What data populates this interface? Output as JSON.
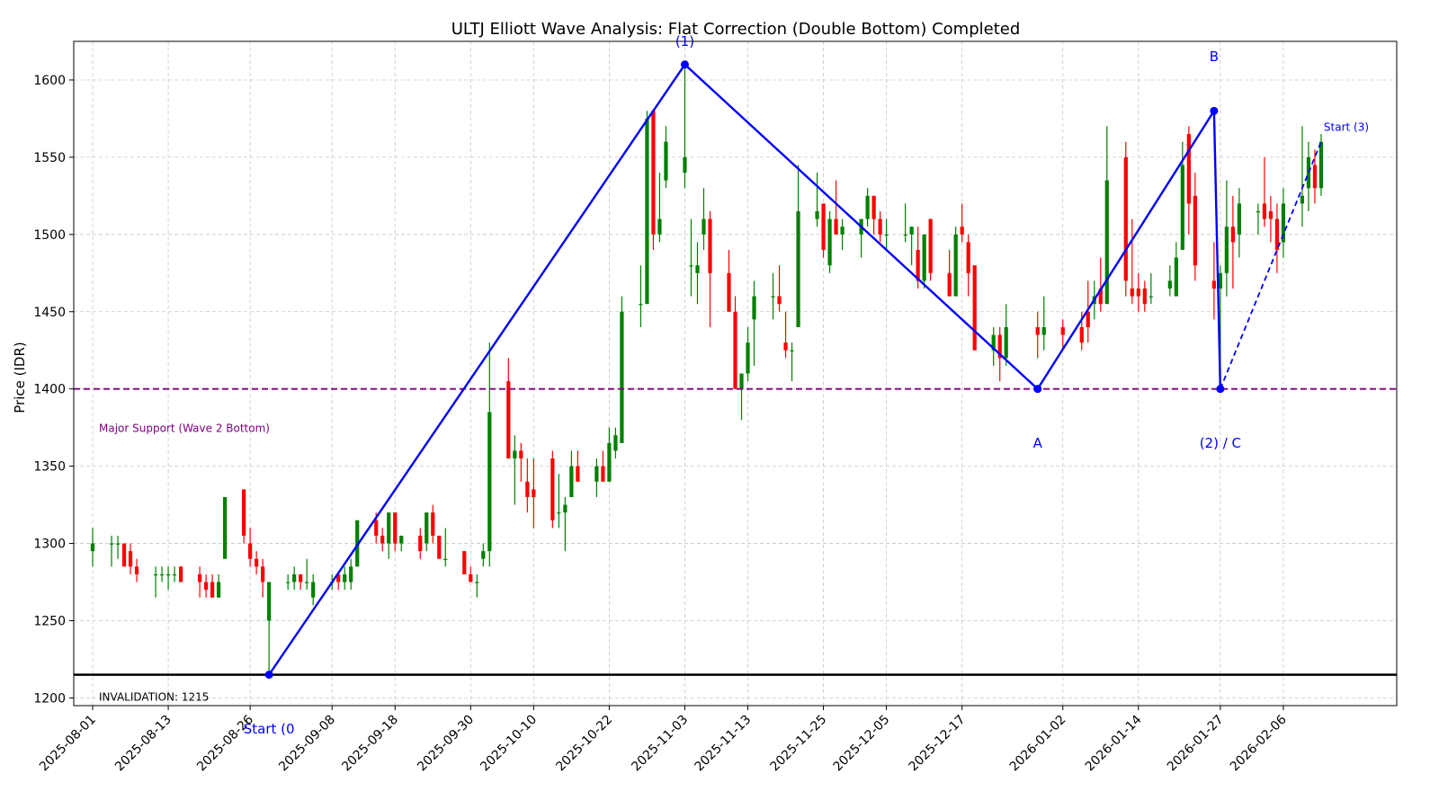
{
  "chart_data": {
    "type": "candlestick",
    "title": "ULTJ Elliott Wave Analysis: Flat Correction (Double Bottom) Completed",
    "xlabel": "",
    "ylabel": "Price (IDR)",
    "ylim": [
      1195,
      1625
    ],
    "x_range": [
      "2025-07-29",
      "2026-02-24"
    ],
    "y_ticks": [
      1200,
      1250,
      1300,
      1350,
      1400,
      1450,
      1500,
      1550,
      1600
    ],
    "x_ticks": [
      "2025-08-01",
      "2025-08-13",
      "2025-08-26",
      "2025-09-08",
      "2025-09-18",
      "2025-09-30",
      "2025-10-10",
      "2025-10-22",
      "2025-11-03",
      "2025-11-13",
      "2025-11-25",
      "2025-12-05",
      "2025-12-17",
      "2026-01-02",
      "2026-01-14",
      "2026-01-27",
      "2026-02-06"
    ],
    "grid": true,
    "colors": {
      "up": "#008000",
      "down": "#ff0000",
      "wave": "#0000ff",
      "support": "#800080",
      "invalidation": "#000000"
    },
    "candles": [
      [
        "2025-08-01",
        1295,
        1310,
        1285,
        1300
      ],
      [
        "2025-08-04",
        1300,
        1305,
        1285,
        1300
      ],
      [
        "2025-08-05",
        1300,
        1305,
        1290,
        1300
      ],
      [
        "2025-08-06",
        1300,
        1300,
        1285,
        1285
      ],
      [
        "2025-08-07",
        1295,
        1300,
        1280,
        1285
      ],
      [
        "2025-08-08",
        1285,
        1290,
        1275,
        1280
      ],
      [
        "2025-08-11",
        1280,
        1285,
        1265,
        1280
      ],
      [
        "2025-08-12",
        1280,
        1285,
        1275,
        1280
      ],
      [
        "2025-08-13",
        1280,
        1285,
        1270,
        1280
      ],
      [
        "2025-08-14",
        1280,
        1285,
        1275,
        1280
      ],
      [
        "2025-08-15",
        1285,
        1285,
        1275,
        1275
      ],
      [
        "2025-08-18",
        1280,
        1285,
        1265,
        1275
      ],
      [
        "2025-08-19",
        1275,
        1280,
        1265,
        1270
      ],
      [
        "2025-08-20",
        1275,
        1280,
        1265,
        1265
      ],
      [
        "2025-08-21",
        1265,
        1280,
        1265,
        1275
      ],
      [
        "2025-08-22",
        1290,
        1330,
        1290,
        1330
      ],
      [
        "2025-08-25",
        1335,
        1335,
        1300,
        1305
      ],
      [
        "2025-08-26",
        1300,
        1310,
        1285,
        1290
      ],
      [
        "2025-08-27",
        1290,
        1295,
        1280,
        1285
      ],
      [
        "2025-08-28",
        1285,
        1290,
        1265,
        1275
      ],
      [
        "2025-08-29",
        1250,
        1275,
        1215,
        1275
      ],
      [
        "2025-09-01",
        1275,
        1280,
        1270,
        1275
      ],
      [
        "2025-09-02",
        1275,
        1285,
        1270,
        1280
      ],
      [
        "2025-09-03",
        1280,
        1280,
        1270,
        1275
      ],
      [
        "2025-09-04",
        1275,
        1290,
        1270,
        1275
      ],
      [
        "2025-09-05",
        1265,
        1280,
        1260,
        1275
      ],
      [
        "2025-09-08",
        1275,
        1280,
        1270,
        1275
      ],
      [
        "2025-09-09",
        1280,
        1280,
        1270,
        1275
      ],
      [
        "2025-09-10",
        1275,
        1285,
        1270,
        1280
      ],
      [
        "2025-09-11",
        1275,
        1290,
        1270,
        1285
      ],
      [
        "2025-09-12",
        1285,
        1315,
        1285,
        1315
      ],
      [
        "2025-09-15",
        1315,
        1320,
        1300,
        1305
      ],
      [
        "2025-09-16",
        1305,
        1310,
        1295,
        1300
      ],
      [
        "2025-09-17",
        1300,
        1320,
        1290,
        1320
      ],
      [
        "2025-09-18",
        1320,
        1320,
        1295,
        1300
      ],
      [
        "2025-09-19",
        1300,
        1305,
        1295,
        1305
      ],
      [
        "2025-09-22",
        1305,
        1310,
        1290,
        1295
      ],
      [
        "2025-09-23",
        1300,
        1320,
        1295,
        1320
      ],
      [
        "2025-09-24",
        1320,
        1325,
        1300,
        1305
      ],
      [
        "2025-09-25",
        1305,
        1305,
        1290,
        1290
      ],
      [
        "2025-09-26",
        1290,
        1310,
        1285,
        1290
      ],
      [
        "2025-09-29",
        1295,
        1295,
        1280,
        1280
      ],
      [
        "2025-09-30",
        1280,
        1285,
        1275,
        1275
      ],
      [
        "2025-10-01",
        1275,
        1280,
        1265,
        1275
      ],
      [
        "2025-10-02",
        1290,
        1300,
        1285,
        1295
      ],
      [
        "2025-10-03",
        1295,
        1430,
        1285,
        1385
      ],
      [
        "2025-10-06",
        1405,
        1420,
        1355,
        1355
      ],
      [
        "2025-10-07",
        1355,
        1370,
        1325,
        1360
      ],
      [
        "2025-10-08",
        1360,
        1365,
        1340,
        1355
      ],
      [
        "2025-10-09",
        1340,
        1355,
        1320,
        1330
      ],
      [
        "2025-10-10",
        1335,
        1355,
        1310,
        1330
      ],
      [
        "2025-10-13",
        1355,
        1360,
        1310,
        1315
      ],
      [
        "2025-10-14",
        1320,
        1345,
        1310,
        1320
      ],
      [
        "2025-10-15",
        1320,
        1330,
        1295,
        1325
      ],
      [
        "2025-10-16",
        1330,
        1360,
        1330,
        1350
      ],
      [
        "2025-10-17",
        1350,
        1360,
        1340,
        1340
      ],
      [
        "2025-10-20",
        1340,
        1355,
        1330,
        1350
      ],
      [
        "2025-10-21",
        1350,
        1360,
        1340,
        1340
      ],
      [
        "2025-10-22",
        1340,
        1375,
        1340,
        1365
      ],
      [
        "2025-10-23",
        1360,
        1375,
        1355,
        1370
      ],
      [
        "2025-10-24",
        1365,
        1460,
        1365,
        1450
      ],
      [
        "2025-10-27",
        1455,
        1480,
        1440,
        1455
      ],
      [
        "2025-10-28",
        1455,
        1580,
        1455,
        1575
      ],
      [
        "2025-10-29",
        1580,
        1580,
        1490,
        1500
      ],
      [
        "2025-10-30",
        1500,
        1540,
        1495,
        1510
      ],
      [
        "2025-10-31",
        1535,
        1570,
        1530,
        1560
      ],
      [
        "2025-11-03",
        1540,
        1610,
        1530,
        1550
      ],
      [
        "2025-11-04",
        1480,
        1510,
        1460,
        1480
      ],
      [
        "2025-11-05",
        1475,
        1495,
        1455,
        1480
      ],
      [
        "2025-11-06",
        1500,
        1530,
        1490,
        1510
      ],
      [
        "2025-11-07",
        1510,
        1515,
        1440,
        1475
      ],
      [
        "2025-11-10",
        1475,
        1490,
        1450,
        1450
      ],
      [
        "2025-11-11",
        1450,
        1460,
        1400,
        1400
      ],
      [
        "2025-11-12",
        1400,
        1410,
        1380,
        1410
      ],
      [
        "2025-11-13",
        1410,
        1440,
        1405,
        1430
      ],
      [
        "2025-11-14",
        1445,
        1470,
        1415,
        1460
      ],
      [
        "2025-11-17",
        1460,
        1475,
        1445,
        1460
      ],
      [
        "2025-11-18",
        1460,
        1480,
        1450,
        1455
      ],
      [
        "2025-11-19",
        1430,
        1450,
        1420,
        1425
      ],
      [
        "2025-11-20",
        1425,
        1430,
        1405,
        1425
      ],
      [
        "2025-11-21",
        1440,
        1545,
        1440,
        1515
      ],
      [
        "2025-11-24",
        1510,
        1540,
        1505,
        1515
      ],
      [
        "2025-11-25",
        1520,
        1520,
        1485,
        1490
      ],
      [
        "2025-11-26",
        1480,
        1515,
        1475,
        1510
      ],
      [
        "2025-11-27",
        1510,
        1535,
        1500,
        1500
      ],
      [
        "2025-11-28",
        1500,
        1510,
        1490,
        1505
      ],
      [
        "2025-12-01",
        1500,
        1510,
        1485,
        1510
      ],
      [
        "2025-12-02",
        1510,
        1530,
        1505,
        1525
      ],
      [
        "2025-12-03",
        1525,
        1525,
        1500,
        1510
      ],
      [
        "2025-12-04",
        1510,
        1515,
        1495,
        1500
      ],
      [
        "2025-12-05",
        1500,
        1510,
        1490,
        1500
      ],
      [
        "2025-12-08",
        1500,
        1520,
        1495,
        1500
      ],
      [
        "2025-12-09",
        1500,
        1505,
        1480,
        1505
      ],
      [
        "2025-12-10",
        1490,
        1505,
        1465,
        1470
      ],
      [
        "2025-12-11",
        1470,
        1500,
        1465,
        1500
      ],
      [
        "2025-12-12",
        1510,
        1510,
        1470,
        1475
      ],
      [
        "2025-12-15",
        1475,
        1490,
        1460,
        1460
      ],
      [
        "2025-12-16",
        1460,
        1505,
        1460,
        1500
      ],
      [
        "2025-12-17",
        1505,
        1520,
        1495,
        1500
      ],
      [
        "2025-12-18",
        1495,
        1500,
        1460,
        1475
      ],
      [
        "2025-12-19",
        1480,
        1480,
        1440,
        1425
      ],
      [
        "2025-12-22",
        1425,
        1440,
        1415,
        1435
      ],
      [
        "2025-12-23",
        1435,
        1440,
        1405,
        1420
      ],
      [
        "2025-12-24",
        1420,
        1455,
        1415,
        1440
      ],
      [
        "2025-12-29",
        1440,
        1450,
        1420,
        1435
      ],
      [
        "2025-12-30",
        1435,
        1460,
        1425,
        1440
      ],
      [
        "2026-01-02",
        1440,
        1445,
        1425,
        1435
      ],
      [
        "2026-01-05",
        1440,
        1450,
        1425,
        1430
      ],
      [
        "2026-01-06",
        1450,
        1470,
        1430,
        1440
      ],
      [
        "2026-01-07",
        1455,
        1470,
        1445,
        1460
      ],
      [
        "2026-01-08",
        1465,
        1485,
        1450,
        1455
      ],
      [
        "2026-01-09",
        1455,
        1570,
        1455,
        1535
      ],
      [
        "2026-01-12",
        1550,
        1560,
        1460,
        1470
      ],
      [
        "2026-01-13",
        1465,
        1510,
        1455,
        1460
      ],
      [
        "2026-01-14",
        1465,
        1475,
        1450,
        1460
      ],
      [
        "2026-01-15",
        1465,
        1470,
        1450,
        1455
      ],
      [
        "2026-01-16",
        1460,
        1475,
        1455,
        1460
      ],
      [
        "2026-01-19",
        1465,
        1480,
        1460,
        1470
      ],
      [
        "2026-01-20",
        1460,
        1495,
        1460,
        1485
      ],
      [
        "2026-01-21",
        1490,
        1560,
        1490,
        1545
      ],
      [
        "2026-01-22",
        1565,
        1570,
        1500,
        1520
      ],
      [
        "2026-01-23",
        1525,
        1540,
        1470,
        1480
      ],
      [
        "2026-01-26",
        1470,
        1495,
        1445,
        1465
      ],
      [
        "2026-01-27",
        1465,
        1480,
        1400,
        1475
      ],
      [
        "2026-01-28",
        1475,
        1535,
        1460,
        1505
      ],
      [
        "2026-01-29",
        1505,
        1525,
        1465,
        1495
      ],
      [
        "2026-01-30",
        1500,
        1530,
        1485,
        1520
      ],
      [
        "2026-02-02",
        1515,
        1520,
        1500,
        1515
      ],
      [
        "2026-02-03",
        1520,
        1550,
        1505,
        1510
      ],
      [
        "2026-02-04",
        1515,
        1525,
        1495,
        1510
      ],
      [
        "2026-02-05",
        1510,
        1520,
        1475,
        1490
      ],
      [
        "2026-02-06",
        1495,
        1530,
        1485,
        1520
      ],
      [
        "2026-02-09",
        1520,
        1570,
        1505,
        1525
      ],
      [
        "2026-02-10",
        1530,
        1560,
        1515,
        1550
      ],
      [
        "2026-02-11",
        1545,
        1555,
        1520,
        1530
      ],
      [
        "2026-02-12",
        1530,
        1565,
        1525,
        1560
      ]
    ],
    "wave_lines": [
      {
        "style": "solid",
        "points": [
          [
            "2025-08-29",
            1215
          ],
          [
            "2025-11-03",
            1610
          ],
          [
            "2025-12-29",
            1400
          ],
          [
            "2026-01-26",
            1580
          ],
          [
            "2026-01-27",
            1400
          ]
        ]
      },
      {
        "style": "dashed",
        "points": [
          [
            "2026-01-27",
            1400
          ],
          [
            "2026-02-12",
            1560
          ]
        ]
      }
    ],
    "wave_labels": [
      {
        "text": "(1)",
        "x": "2025-11-03",
        "y": 1625,
        "size": "large"
      },
      {
        "text": "A",
        "x": "2025-12-29",
        "y": 1365,
        "size": "large"
      },
      {
        "text": "B",
        "x": "2026-01-26",
        "y": 1615,
        "size": "large"
      },
      {
        "text": "(2) / C",
        "x": "2026-01-27",
        "y": 1365,
        "size": "large"
      },
      {
        "text": "Start (0",
        "x": "2025-08-29",
        "y": 1180,
        "size": "large"
      },
      {
        "text": "Start (3)",
        "x": "2026-02-16",
        "y": 1570,
        "size": "small"
      }
    ],
    "support": {
      "value": 1400,
      "label": "Major Support (Wave 2 Bottom)"
    },
    "invalidation": {
      "value": 1215,
      "label": "INVALIDATION: 1215"
    }
  }
}
